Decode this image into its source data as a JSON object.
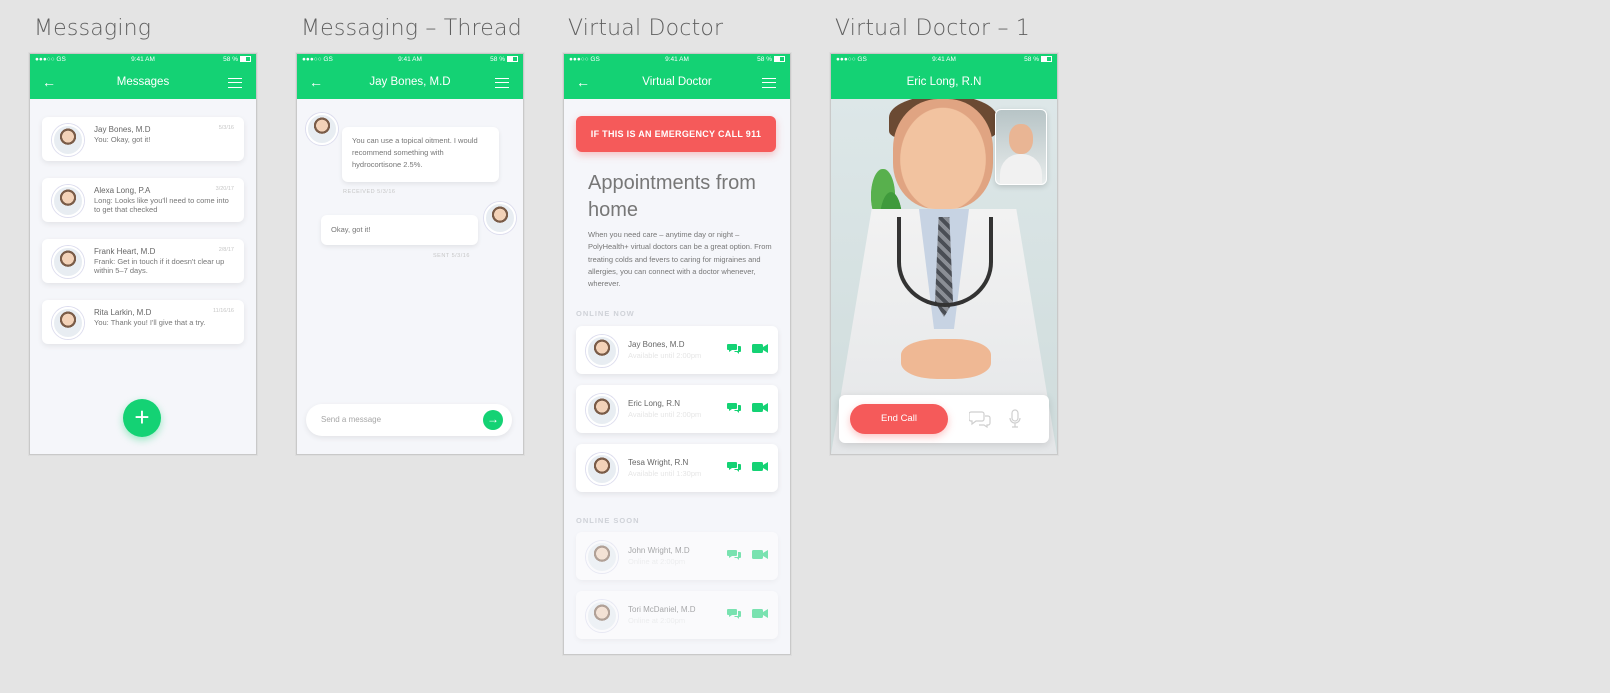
{
  "artboards": [
    {
      "title": "Messaging"
    },
    {
      "title": "Messaging – Thread"
    },
    {
      "title": "Virtual Doctor"
    },
    {
      "title": "Virtual Doctor – 1"
    }
  ],
  "status_bar": {
    "carrier": "●●●○○ GS ",
    "time": "9:41 AM",
    "battery": "58 %"
  },
  "messages": {
    "title": "Messages",
    "items": [
      {
        "name": "Jay Bones, M.D",
        "date": "5/3/16",
        "preview": "You: Okay, got it!"
      },
      {
        "name": "Alexa Long, P.A",
        "date": "3/20/17",
        "preview": "Long: Looks like you'll need to come into to get that checked"
      },
      {
        "name": "Frank Heart, M.D",
        "date": "2/8/17",
        "preview": "Frank: Get in touch if it doesn't clear up within 5–7 days."
      },
      {
        "name": "Rita Larkin, M.D",
        "date": "11/16/16",
        "preview": "You: Thank you! I'll give that a try."
      }
    ],
    "fab_icon": "plus-icon"
  },
  "thread": {
    "title": "Jay Bones, M.D",
    "received_text": "You can use a topical oitment. I would recommend something with hydrocortisone 2.5%.",
    "received_meta": "RECEIVED 5/3/16",
    "sent_text": "Okay, got it!",
    "sent_meta": "SENT 5/3/16",
    "composer_placeholder": "Send a message"
  },
  "virtual_doctor": {
    "title": "Virtual Doctor",
    "emergency_label": "IF THIS IS AN EMERGENCY CALL 911",
    "headline": "Appointments from home",
    "body": "When you need care – anytime day or night – PolyHealth+ virtual doctors can be a great option. From treating colds and fevers to caring for migraines and allergies, you can connect with a doctor whenever, wherever.",
    "online_now_label": "ONLINE NOW",
    "online_now": [
      {
        "name": "Jay Bones, M.D",
        "availability": "Available until 2:00pm"
      },
      {
        "name": "Eric Long, R.N",
        "availability": "Available until 2:00pm"
      },
      {
        "name": "Tesa Wright, R.N",
        "availability": "Available until 1:30pm"
      }
    ],
    "online_soon_label": "ONLINE SOON",
    "online_soon": [
      {
        "name": "John Wright, M.D",
        "availability": "Online at 2:00pm"
      },
      {
        "name": "Tori McDaniel, M.D",
        "availability": "Online at 2:00pm"
      }
    ]
  },
  "call": {
    "title": "Eric Long, R.N",
    "end_call_label": "End Call"
  },
  "colors": {
    "accent": "#14d274",
    "danger": "#f55a5a",
    "background": "#e4e4e4"
  }
}
